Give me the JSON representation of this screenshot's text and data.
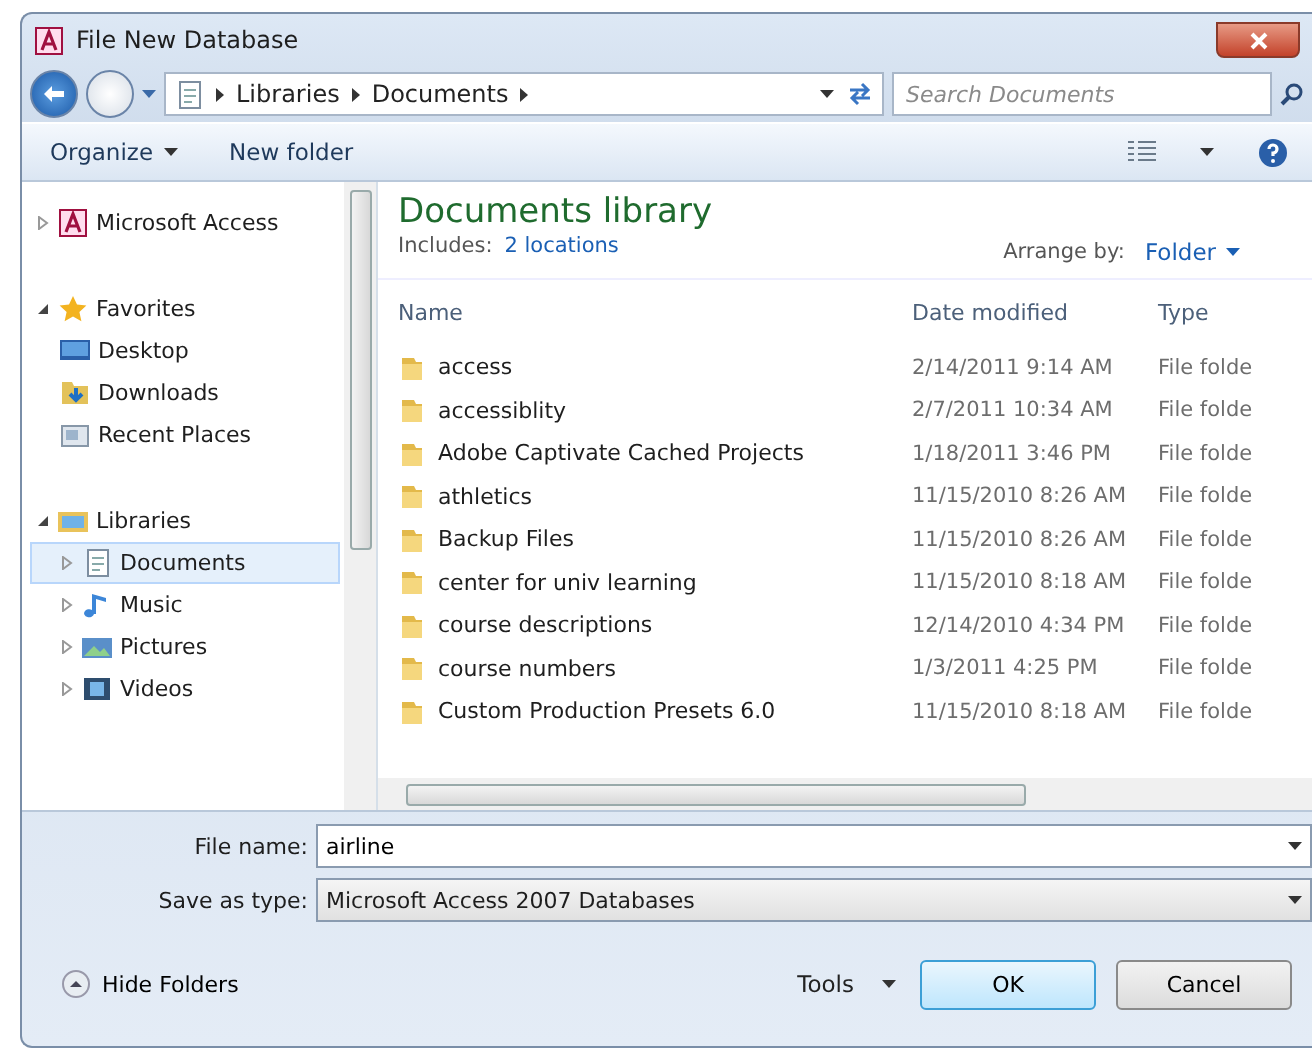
{
  "window": {
    "title": "File New Database"
  },
  "address": {
    "crumbs": [
      "Libraries",
      "Documents"
    ],
    "search_placeholder": "Search Documents"
  },
  "toolbar": {
    "organize": "Organize",
    "new_folder": "New folder"
  },
  "sidebar": {
    "items": [
      {
        "label": "Microsoft Access",
        "kind": "access",
        "expanded": false,
        "selected": false
      },
      {
        "label": "Favorites",
        "kind": "star",
        "expanded": true,
        "selected": false,
        "children": [
          {
            "label": "Desktop",
            "kind": "desktop",
            "selected": false
          },
          {
            "label": "Downloads",
            "kind": "download",
            "selected": false
          },
          {
            "label": "Recent Places",
            "kind": "recent",
            "selected": false
          }
        ]
      },
      {
        "label": "Libraries",
        "kind": "library",
        "expanded": true,
        "selected": false,
        "children": [
          {
            "label": "Documents",
            "kind": "document",
            "selected": true
          },
          {
            "label": "Music",
            "kind": "music",
            "selected": false
          },
          {
            "label": "Pictures",
            "kind": "picture",
            "selected": false
          },
          {
            "label": "Videos",
            "kind": "video",
            "selected": false
          }
        ]
      }
    ]
  },
  "library": {
    "title": "Documents library",
    "includes_label": "Includes:",
    "includes_link": "2 locations",
    "arrange_label": "Arrange by:",
    "arrange_value": "Folder"
  },
  "table": {
    "columns": [
      "Name",
      "Date modified",
      "Type"
    ],
    "rows": [
      {
        "name": "access",
        "date": "2/14/2011 9:14 AM",
        "type": "File folde"
      },
      {
        "name": "accessiblity",
        "date": "2/7/2011 10:34 AM",
        "type": "File folde"
      },
      {
        "name": "Adobe Captivate Cached Projects",
        "date": "1/18/2011 3:46 PM",
        "type": "File folde"
      },
      {
        "name": "athletics",
        "date": "11/15/2010 8:26 AM",
        "type": "File folde"
      },
      {
        "name": "Backup Files",
        "date": "11/15/2010 8:26 AM",
        "type": "File folde"
      },
      {
        "name": "center for univ learning",
        "date": "11/15/2010 8:18 AM",
        "type": "File folde"
      },
      {
        "name": "course descriptions",
        "date": "12/14/2010 4:34 PM",
        "type": "File folde"
      },
      {
        "name": "course numbers",
        "date": "1/3/2011 4:25 PM",
        "type": "File folde"
      },
      {
        "name": "Custom Production Presets 6.0",
        "date": "11/15/2010 8:18 AM",
        "type": "File folde"
      }
    ]
  },
  "form": {
    "file_name_label": "File name:",
    "file_name": "airline",
    "type_label": "Save as type:",
    "type_value": "Microsoft Access 2007 Databases"
  },
  "footer": {
    "hide_folders": "Hide Folders",
    "tools": "Tools",
    "ok": "OK",
    "cancel": "Cancel"
  }
}
